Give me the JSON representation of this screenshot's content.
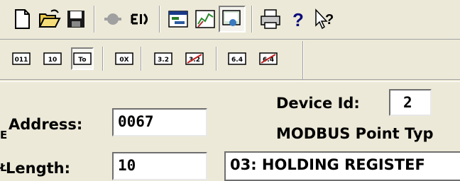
{
  "toolbar_main": {
    "buttons": [
      {
        "icon": "new-document-icon"
      },
      {
        "icon": "open-folder-icon"
      },
      {
        "icon": "save-disk-icon"
      },
      {
        "icon": "disconnect-icon"
      },
      {
        "icon": "connect-icon"
      },
      {
        "icon": "properties-icon"
      },
      {
        "icon": "chart-tool-icon"
      },
      {
        "icon": "monitor-icon"
      },
      {
        "icon": "print-icon"
      },
      {
        "icon": "help-icon"
      },
      {
        "icon": "context-help-icon"
      }
    ],
    "help_glyph": "?",
    "context_help_glyph": "?"
  },
  "toolbar_format": {
    "buttons": [
      {
        "label": "011",
        "icon": "binary-format-icon"
      },
      {
        "label": "10",
        "icon": "decimal-format-icon"
      },
      {
        "label": "To",
        "icon": "unsigned-format-icon",
        "pressed": true
      },
      {
        "label": "0X",
        "icon": "hex-format-icon"
      },
      {
        "label": "3.2",
        "icon": "float-format-icon"
      },
      {
        "label": "3.2",
        "icon": "float-swapped-format-icon"
      },
      {
        "label": "6.4",
        "icon": "double-format-icon"
      },
      {
        "label": "6.4",
        "icon": "double-swapped-format-icon"
      }
    ]
  },
  "form": {
    "device_id_label": "Device Id:",
    "device_id_value": "2",
    "point_type_label": "MODBUS Point Typ",
    "point_type_value": "03: HOLDING REGISTEF",
    "address_label": "Address:",
    "address_value": "0067",
    "length_label": "Length:",
    "length_value": "10",
    "clipped_left_top": "E",
    "clipped_left_bottom": "Ł"
  }
}
